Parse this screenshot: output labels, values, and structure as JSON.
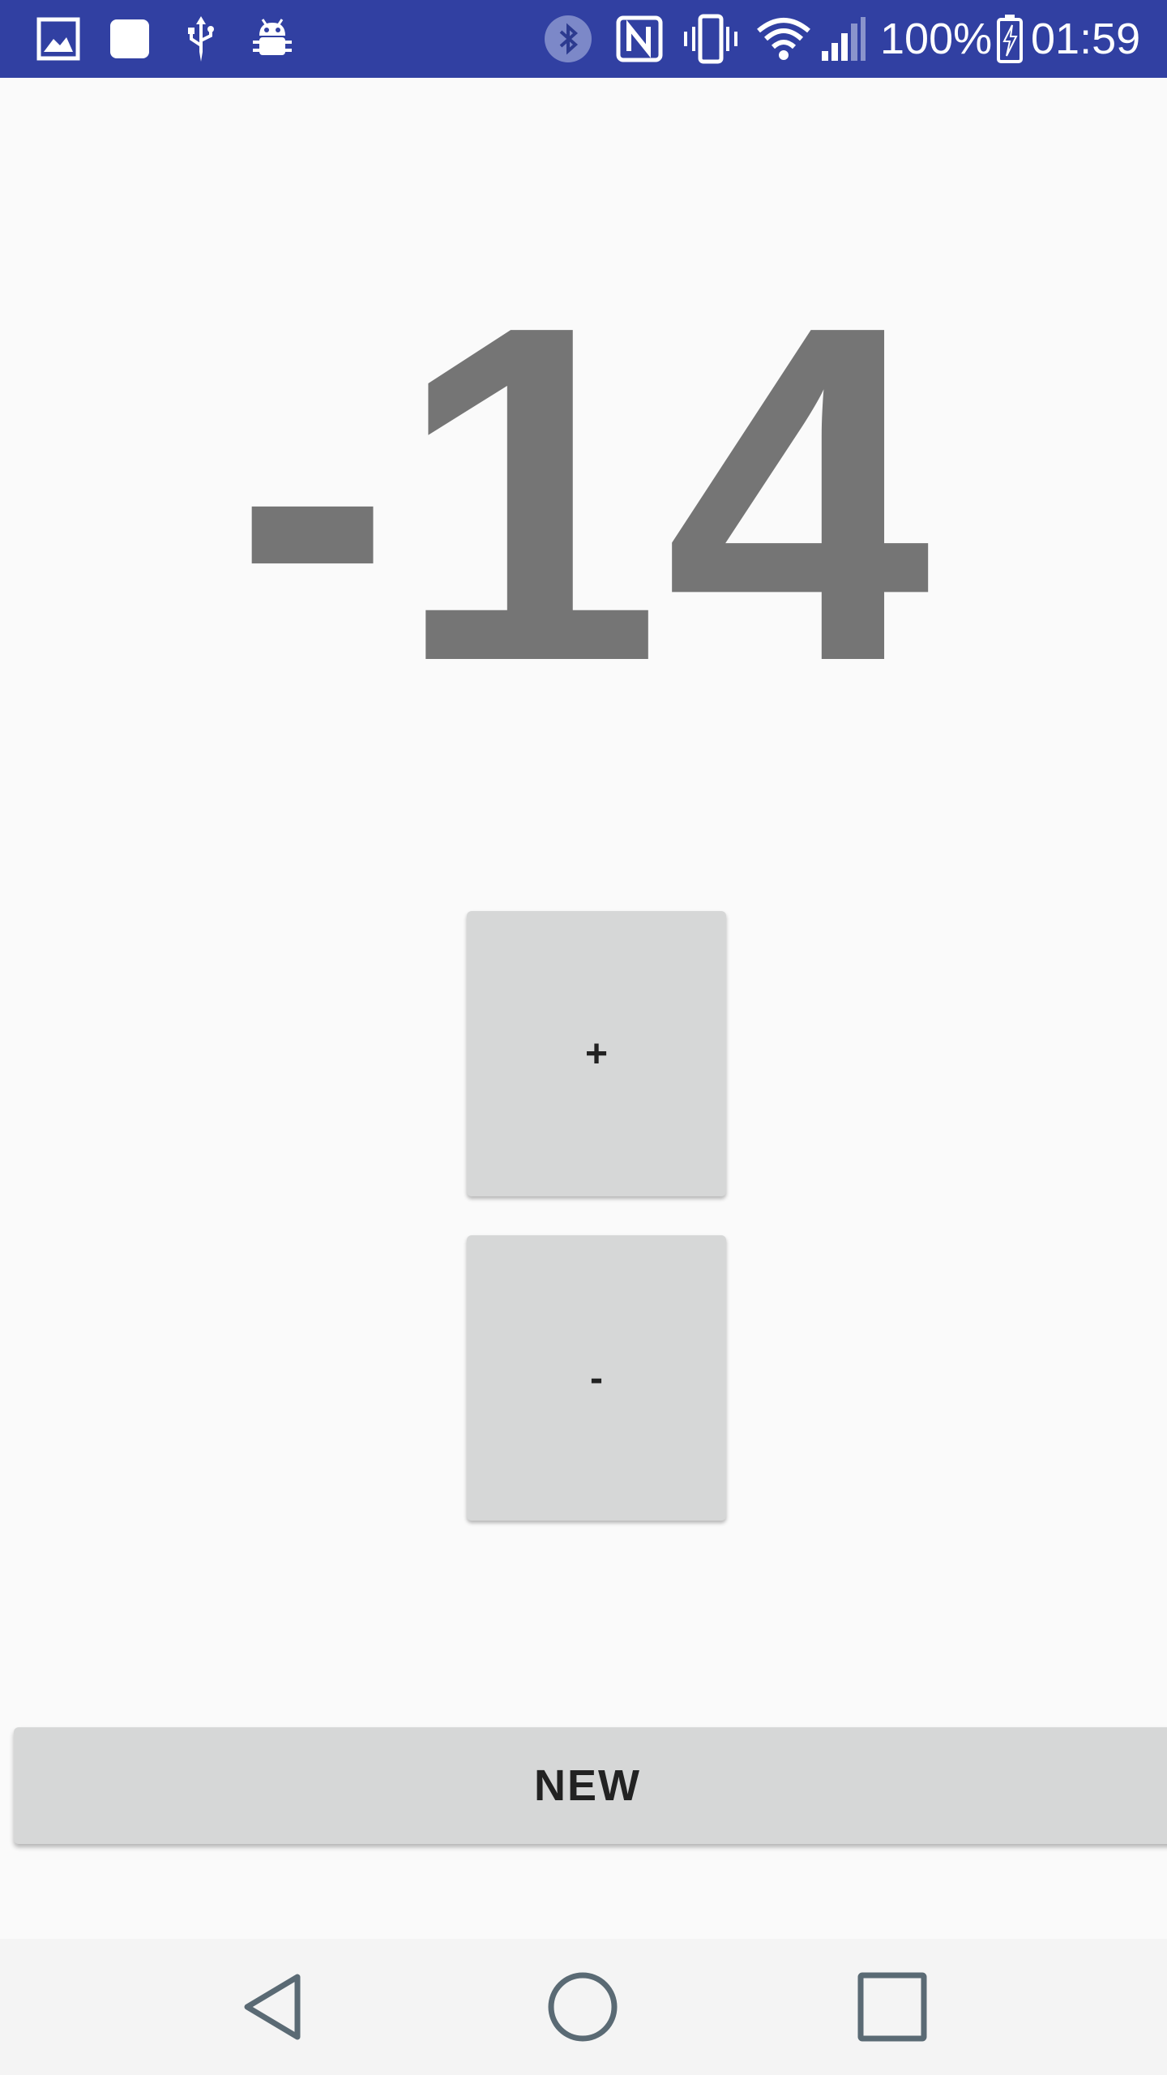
{
  "status_bar": {
    "background": "#3140a2",
    "left_icons": [
      "image-icon",
      "square-notification-icon",
      "usb-icon",
      "android-debug-icon"
    ],
    "right_icons": [
      "bluetooth-icon",
      "nfc-icon",
      "vibrate-icon",
      "wifi-icon",
      "signal-icon",
      "battery-charging-icon"
    ],
    "battery_percent": "100%",
    "time": "01:59"
  },
  "counter": {
    "value": "-14",
    "color": "#757575"
  },
  "controls": {
    "increment_label": "+",
    "decrement_label": "-",
    "new_label": "NEW",
    "button_color": "#d6d7d7"
  },
  "nav_bar": {
    "icons": [
      "back-icon",
      "home-icon",
      "recents-icon"
    ],
    "icon_color": "#5a6a74"
  }
}
